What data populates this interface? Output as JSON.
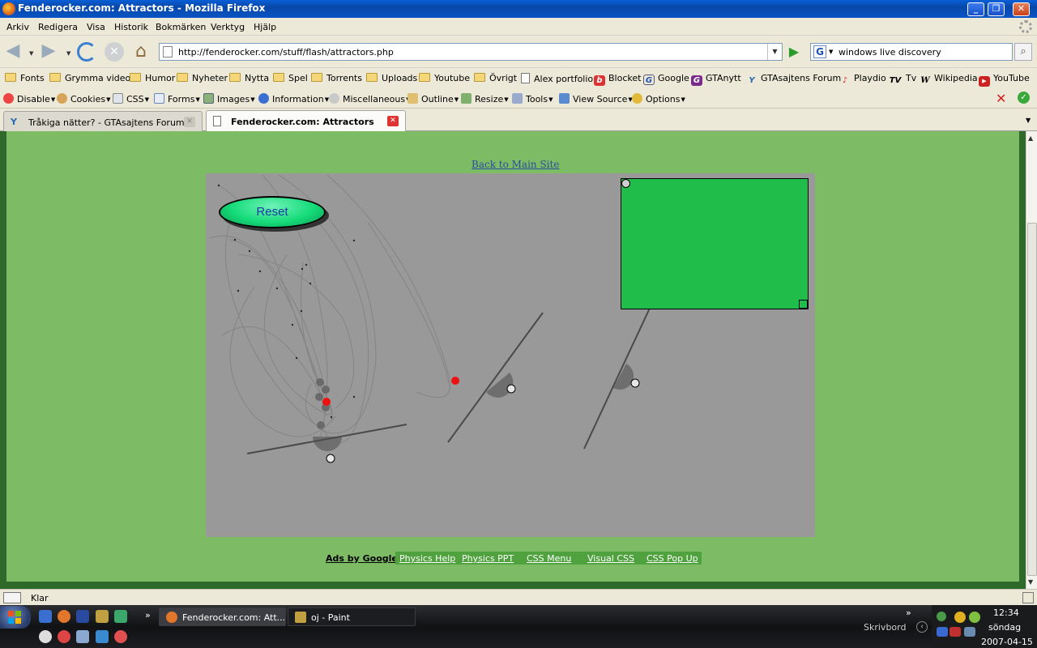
{
  "window": {
    "title": "Fenderocker.com: Attractors - Mozilla Firefox",
    "controls": [
      "_",
      "❐",
      "✕"
    ]
  },
  "menu": [
    "Arkiv",
    "Redigera",
    "Visa",
    "Historik",
    "Bokmärken",
    "Verktyg",
    "Hjälp"
  ],
  "nav": {
    "url": "http://fenderocker.com/stuff/flash/attractors.php",
    "search_value": "windows live discovery"
  },
  "bookmarks": [
    {
      "label": "Fonts",
      "icon": "folder-icon"
    },
    {
      "label": "Grymma videor",
      "icon": "folder-icon"
    },
    {
      "label": "Humor",
      "icon": "folder-icon"
    },
    {
      "label": "Nyheter",
      "icon": "folder-icon"
    },
    {
      "label": "Nytta",
      "icon": "folder-icon"
    },
    {
      "label": "Spel",
      "icon": "folder-icon"
    },
    {
      "label": "Torrents",
      "icon": "folder-icon"
    },
    {
      "label": "Uploads",
      "icon": "folder-icon"
    },
    {
      "label": "Youtube",
      "icon": "folder-icon"
    },
    {
      "label": "Övrigt",
      "icon": "folder-icon"
    },
    {
      "label": "Alex portfolio",
      "icon": "page-icon"
    },
    {
      "label": "Blocket",
      "icon": "blocket-icon"
    },
    {
      "label": "Google",
      "icon": "google-icon"
    },
    {
      "label": "GTAnytt",
      "icon": "gtanytt-icon"
    },
    {
      "label": "GTAsajtens Forum",
      "icon": "gtasajten-icon"
    },
    {
      "label": "Playdio",
      "icon": "playdio-icon"
    },
    {
      "label": "Tv",
      "icon": "tv-icon"
    },
    {
      "label": "Wikipedia",
      "icon": "wikipedia-icon"
    },
    {
      "label": "YouTube",
      "icon": "youtube-icon"
    }
  ],
  "devbar": [
    {
      "label": "Disable",
      "icon": "disable-icon"
    },
    {
      "label": "Cookies",
      "icon": "cookies-icon"
    },
    {
      "label": "CSS",
      "icon": "css-icon"
    },
    {
      "label": "Forms",
      "icon": "forms-icon"
    },
    {
      "label": "Images",
      "icon": "images-icon"
    },
    {
      "label": "Information",
      "icon": "information-icon"
    },
    {
      "label": "Miscellaneous",
      "icon": "miscellaneous-icon"
    },
    {
      "label": "Outline",
      "icon": "outline-icon"
    },
    {
      "label": "Resize",
      "icon": "resize-icon"
    },
    {
      "label": "Tools",
      "icon": "tools-icon"
    },
    {
      "label": "View Source",
      "icon": "view-source-icon"
    },
    {
      "label": "Options",
      "icon": "options-icon"
    }
  ],
  "tabs": [
    {
      "label": "Tråkiga nätter? - GTAsajtens Forum",
      "active": false
    },
    {
      "label": "Fenderocker.com: Attractors",
      "active": true
    }
  ],
  "page": {
    "back_link": "Back to Main Site",
    "reset_label": "Reset",
    "ads_label": "Ads by Google",
    "ad_links": [
      "Physics Help",
      "Physics PPT",
      "CSS Menu",
      "Visual CSS",
      "CSS Pop Up"
    ]
  },
  "status": "Klar",
  "taskbar": {
    "tasks": [
      {
        "label": "Fenderocker.com: Att...",
        "icon": "firefox-icon",
        "active": true
      },
      {
        "label": "oj - Paint",
        "icon": "paint-icon",
        "active": false
      }
    ],
    "desktop_label": "Skrivbord",
    "time": "12:34",
    "day": "söndag",
    "date": "2007-04-15"
  },
  "colors": {
    "page_green": "#7dbb64",
    "page_border": "#2f6a2a",
    "flash_bg": "#999999",
    "target_box": "#20bd4a",
    "reset_button": "#16dc7a",
    "particle_red": "#ee1111",
    "ads_bar": "#4fa23e"
  }
}
